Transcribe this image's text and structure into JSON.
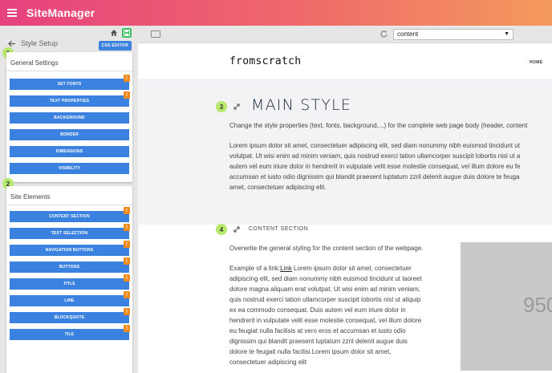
{
  "app": {
    "title": "SiteManager"
  },
  "left_panel": {
    "back_label": "Style Setup",
    "css_editor_label": "CSS EDITOR",
    "general": {
      "badge": "1",
      "title": "General Settings",
      "items": [
        {
          "label": "SET FONTS",
          "warn": "!"
        },
        {
          "label": "TEXT PROPERTIES",
          "warn": "!"
        },
        {
          "label": "BACKGROUND"
        },
        {
          "label": "BORDER"
        },
        {
          "label": "DIMENSIONS"
        },
        {
          "label": "VISIBILITY"
        }
      ]
    },
    "elements": {
      "badge": "2",
      "title": "Site Elements",
      "items": [
        {
          "label": "CONTENT SECTION",
          "warn": "!"
        },
        {
          "label": "TEXT SELECTION",
          "warn": "!"
        },
        {
          "label": "NAVIGATION BUTTONS",
          "warn": "!"
        },
        {
          "label": "BUTTONS",
          "warn": "!"
        },
        {
          "label": "TITLE",
          "warn": "!"
        },
        {
          "label": "LINE",
          "warn": "!"
        },
        {
          "label": "BLOCKQUOTE",
          "warn": "!"
        },
        {
          "label": "TILE",
          "warn": "!"
        }
      ]
    }
  },
  "preview": {
    "select_value": "content",
    "site_logo": "fromscratch",
    "nav_item": "HOME",
    "main_style": {
      "badge": "3",
      "heading": "MAIN STYLE",
      "intro": "Change the style properties (text, fonts, background,...) for the complete web page body (header, content",
      "lines": [
        "Lorem ipsum dolor sit amet, consectetuer adipiscing elit, sed diam nonummy nibh euismod tincidunt ut",
        "volutpat. Ut wisi enim ad minim veniam, quis nostrud exerci tation ullamcorper suscipit lobortis nisl ut a",
        "autem vel eum iriure dolor in hendrerit in vulputate velit esse molestie consequat, vel illum dolore eu fe",
        "accumsan et iusto odio dignissim qui blandit praesent luptatum zzril delenit augue duis dolore te feuga",
        "amet, consectetuer adipiscing elit."
      ]
    },
    "content_section": {
      "badge": "4",
      "heading": "CONTENT SECTION",
      "intro": "Overwrite the general styling for the content section of the webpage.",
      "link_prefix": "Example of a link:",
      "link_text": "Link",
      "first_line_rest": " Lorem ipsum dolor sit amet, consectetuer",
      "lines": [
        "adipiscing elit, sed diam nonummy nibh euismod tincidunt ut laoreet",
        "dolore magna aliquam erat volutpat. Ut wisi enim ad minim veniam,",
        "quis nostrud exerci tation ullamcorper suscipit lobortis nisl ut aliquip",
        "ex ea commodo consequat. Duis autem vel eum iriure dolor in",
        "hendrerit in vulputate velit esse molestie consequat, vel illum dolore",
        "eu feugiat nulla facilisis at vero eros et accumsan et iusto odio",
        "dignissim qui blandit praesent luptatum zzril delenit augue duis",
        "dolore te feugait nulla facilisi.Lorem ipsum dolor sit amet,",
        "consectetuer adipiscing elit"
      ],
      "image_text": "950"
    }
  },
  "colors": {
    "accent_blue": "#3b82e0",
    "warn_orange": "#f28b1e",
    "badge_green": "#b6e96c"
  }
}
